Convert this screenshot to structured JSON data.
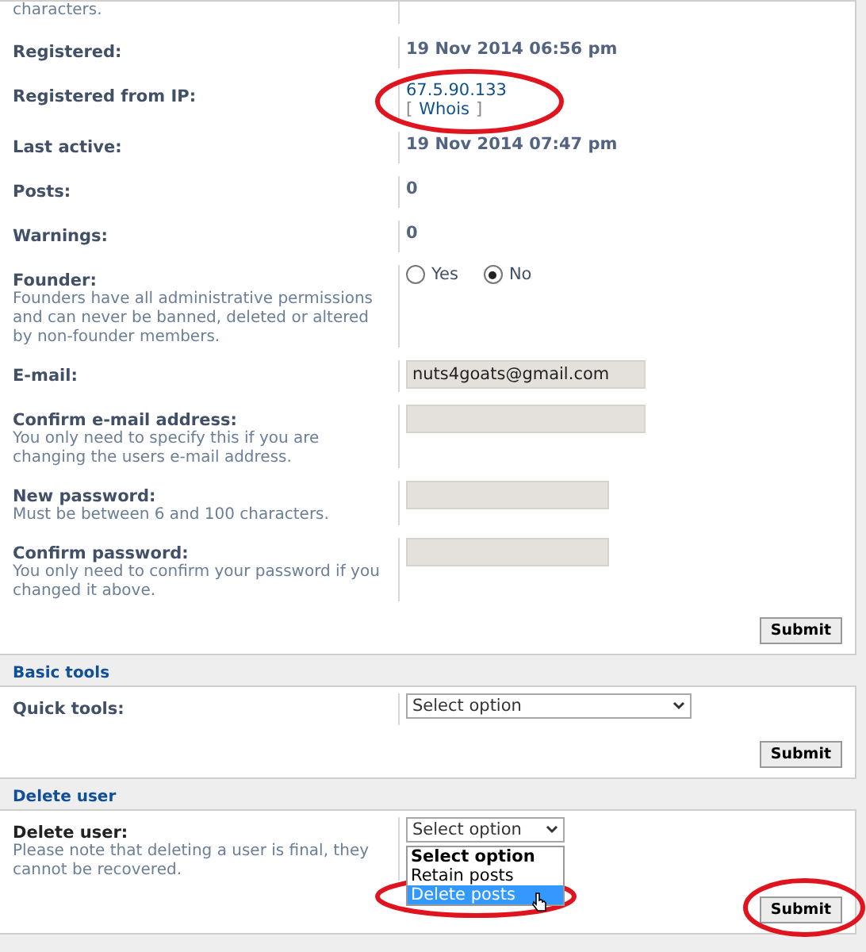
{
  "sections": [
    {
      "rows": [
        {
          "kind": "note",
          "explain": "characters."
        },
        {
          "kind": "text",
          "label": "Registered:",
          "value": "19 Nov 2014 06:56 pm"
        },
        {
          "kind": "ip",
          "label": "Registered from IP:",
          "link": "67.5.90.133",
          "open": "[",
          "whois": "Whois",
          "close": "]",
          "circled": true
        },
        {
          "kind": "text",
          "label": "Last active:",
          "value": "19 Nov 2014 07:47 pm"
        },
        {
          "kind": "text",
          "label": "Posts:",
          "value": "0"
        },
        {
          "kind": "text",
          "label": "Warnings:",
          "value": "0"
        },
        {
          "kind": "radio",
          "label": "Founder:",
          "explain": "Founders have all administrative permissions and can never be banned, deleted or altered by non-founder members.",
          "options": [
            {
              "label": "Yes",
              "selected": false
            },
            {
              "label": "No",
              "selected": true
            }
          ]
        },
        {
          "kind": "input",
          "label": "E-mail:",
          "value": "nuts4goats@gmail.com"
        },
        {
          "kind": "input",
          "label": "Confirm e-mail address:",
          "explain": "You only need to specify this if you are changing the users e-mail address."
        },
        {
          "kind": "password",
          "label": "New password:",
          "explain": "Must be between 6 and 100 characters."
        },
        {
          "kind": "password",
          "label": "Confirm password:",
          "explain": "You only need to confirm your password if you changed it above."
        }
      ],
      "submit": {
        "label": "Submit"
      }
    },
    {
      "heading": "Basic tools",
      "rows": [
        {
          "kind": "select",
          "label": "Quick tools:",
          "value": "Select option"
        }
      ],
      "submit": {
        "label": "Submit"
      }
    },
    {
      "heading": "Delete user",
      "rows": [
        {
          "kind": "dropdown",
          "label": "Delete user:",
          "explain": "Please note that deleting a user is final, they cannot be recovered.",
          "value": "Select option",
          "options": [
            {
              "label": "Select option",
              "selected": true,
              "highlighted": false
            },
            {
              "label": "Retain posts",
              "selected": false,
              "highlighted": false
            },
            {
              "label": "Delete posts",
              "selected": false,
              "highlighted": true,
              "circled": true
            }
          ]
        }
      ],
      "submit": {
        "label": "Submit",
        "circled": true
      }
    }
  ]
}
